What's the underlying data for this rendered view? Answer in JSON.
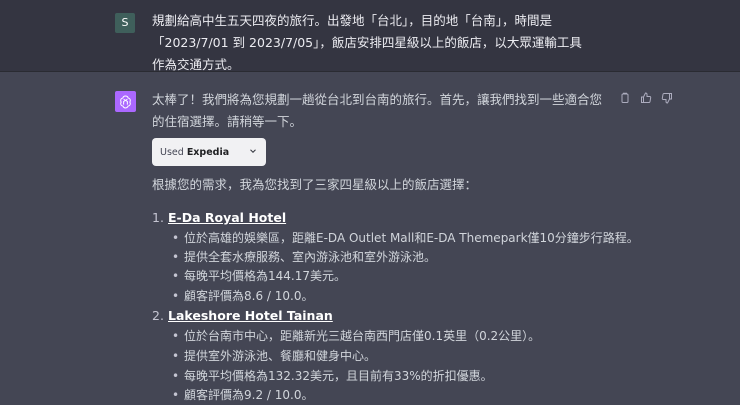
{
  "user": {
    "avatar": "S",
    "message": "規劃給高中生五天四夜的旅行。出發地「台北」，目的地「台南」，時間是「2023/7/01 到 2023/7/05」，飯店安排四星級以上的飯店，以大眾運輸工具作為交通方式。"
  },
  "assistant": {
    "avatar_icon": "openai-logo-icon",
    "intro_line": "太棒了！我們將為您規劃一趟從台北到台南的旅行。首先，讓我們找到一些適合您的住宿選擇。請稍等一下。",
    "actions": [
      "copy-icon",
      "thumbs-up-icon",
      "thumbs-down-icon"
    ],
    "plugin": {
      "used_label": "Used",
      "plugin_name": "Expedia"
    },
    "results_intro": "根據您的需求，我為您找到了三家四星級以上的飯店選擇：",
    "hotels": [
      {
        "number": "1.",
        "name": "E-Da Royal Hotel",
        "details": [
          "位於高雄的娛樂區，距離E-DA Outlet Mall和E-DA Themepark僅10分鐘步行路程。",
          "提供全套水療服務、室內游泳池和室外游泳池。",
          "每晚平均價格為144.17美元。",
          "顧客評價為8.6 / 10.0。"
        ]
      },
      {
        "number": "2.",
        "name": "Lakeshore Hotel Tainan",
        "details": [
          "位於台南市中心，距離新光三越台南西門店僅0.1英里（0.2公里）。",
          "提供室外游泳池、餐廳和健身中心。",
          "每晚平均價格為132.32美元，且目前有33%的折扣優惠。",
          "顧客評價為9.2 / 10.0。"
        ]
      }
    ]
  },
  "colors": {
    "user_bg": "#343541",
    "assistant_bg": "#444654",
    "gpt_avatar": "#ab68ff",
    "user_avatar": "#3f5f5b"
  }
}
